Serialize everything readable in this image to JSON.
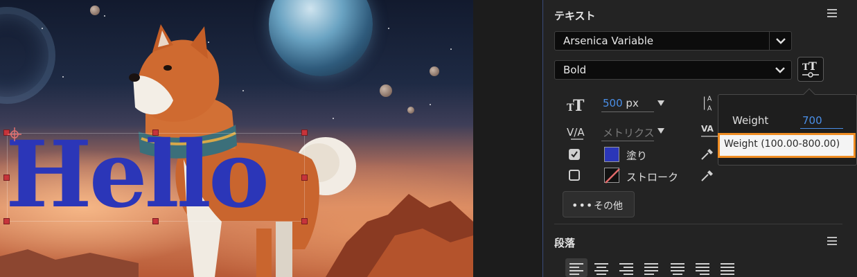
{
  "canvas": {
    "hello_text": "Hello",
    "text_color": "#2b36b8"
  },
  "text_section": {
    "title": "テキスト",
    "font_family": "Arsenica Variable",
    "font_style": "Bold",
    "font_size_value": "500",
    "font_size_unit": "px",
    "kerning_value": "メトリクス",
    "fill_checked": true,
    "fill_label": "塗り",
    "fill_color": "#2b36b8",
    "stroke_checked": false,
    "stroke_label": "ストローク",
    "more_label": "その他",
    "more_dots": "•••"
  },
  "variable_popover": {
    "weight_label": "Weight",
    "weight_value": "700",
    "tooltip": "Weight (100.00-800.00)"
  },
  "paragraph_section": {
    "title": "段落"
  },
  "colors": {
    "accent_blue": "#4a8fe8",
    "highlight_orange": "#ef8d24"
  }
}
